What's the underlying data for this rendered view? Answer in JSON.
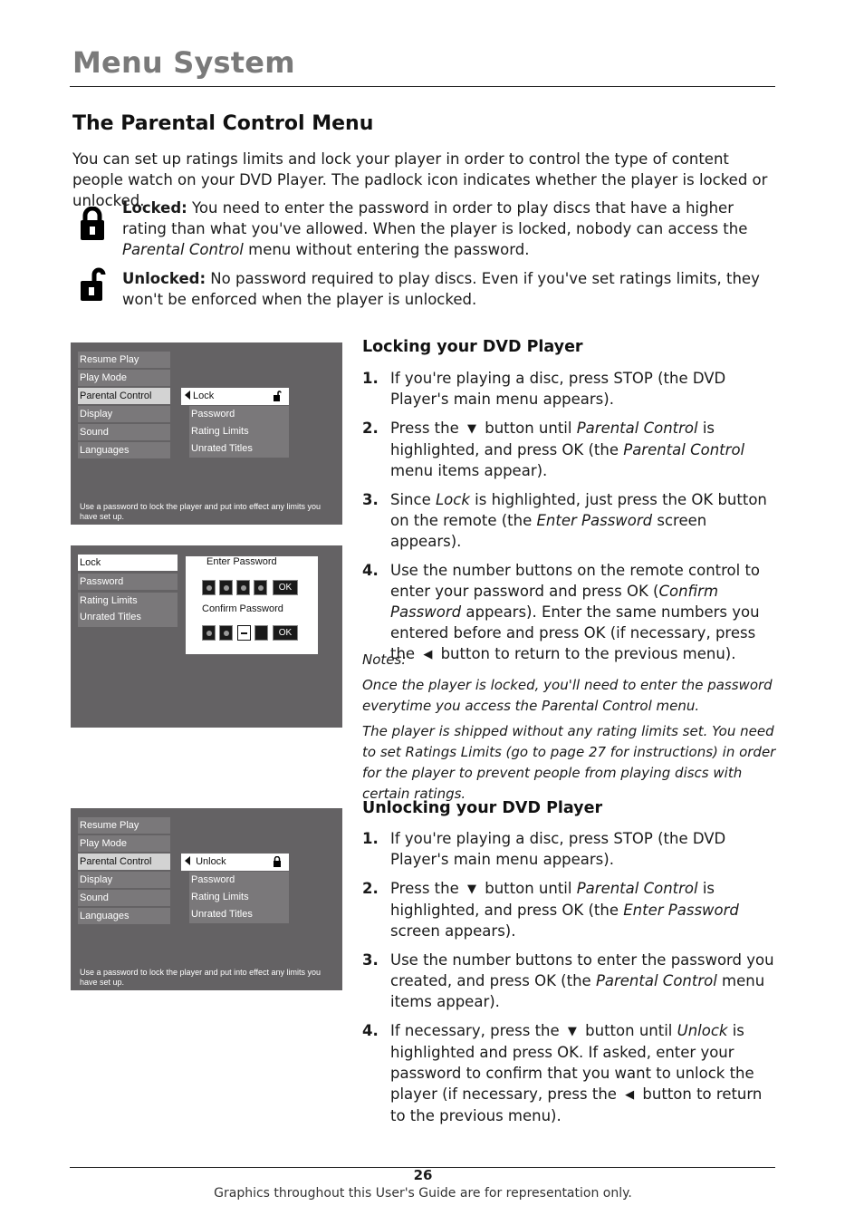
{
  "header": {
    "title": "Menu System"
  },
  "section": {
    "title": "The Parental Control Menu",
    "intro": "You can set up ratings limits and lock your player in order to control the type of content people watch on your DVD Player. The padlock icon indicates whether the player is locked or unlocked."
  },
  "legend": {
    "locked": {
      "icon": "padlock-closed-icon",
      "label": "Locked:",
      "text_before": " You need to enter the password in order to play discs that have a higher rating than what you've allowed. When the player is locked, nobody can access the ",
      "text_italic": "Parental Control",
      "text_after": " menu without entering the password."
    },
    "unlocked": {
      "icon": "padlock-open-icon",
      "label": "Unlocked:",
      "text": " No password required to play discs. Even if you've set ratings limits, they won't be enforced when the player is unlocked."
    }
  },
  "screens": {
    "main_menu": [
      "Resume Play",
      "Play Mode",
      "Parental Control",
      "Display",
      "Sound",
      "Languages"
    ],
    "active_main": "Parental Control",
    "screen1": {
      "selected_sub": "Lock",
      "sub_items": [
        "Password",
        "Rating Limits",
        "Unrated Titles"
      ],
      "note": "Use a password to lock the player and put into effect any limits you have set up."
    },
    "screen2": {
      "left_items": [
        "Lock",
        "Password",
        "Rating Limits",
        "Unrated Titles"
      ],
      "enter_label": "Enter Password",
      "confirm_label": "Confirm Password",
      "ok_label": "OK",
      "enter_digits_filled": 4,
      "confirm_digits_filled": 2
    },
    "screen3": {
      "selected_sub": "Unlock",
      "sub_items": [
        "Password",
        "Rating Limits",
        "Unrated Titles"
      ],
      "note": "Use a password to lock the player and put into effect any limits you have set up."
    }
  },
  "locking": {
    "title": "Locking your DVD Player",
    "steps": [
      {
        "num": "1.",
        "parts": [
          {
            "t": "If you're playing a disc, press STOP (the DVD Player's main menu appears)."
          }
        ]
      },
      {
        "num": "2.",
        "parts": [
          {
            "t": "Press the "
          },
          {
            "arrow": "▼"
          },
          {
            "t": " button until "
          },
          {
            "i": "Parental Control"
          },
          {
            "t": " is highlighted, and press OK (the "
          },
          {
            "i": "Parental Control"
          },
          {
            "t": " menu items appear)."
          }
        ]
      },
      {
        "num": "3.",
        "parts": [
          {
            "t": "Since "
          },
          {
            "i": "Lock"
          },
          {
            "t": " is highlighted, just press the OK button on the remote (the "
          },
          {
            "i": "Enter Password"
          },
          {
            "t": " screen appears)."
          }
        ]
      },
      {
        "num": "4.",
        "parts": [
          {
            "t": "Use the number buttons on the remote control to enter your password and press OK ("
          },
          {
            "i": "Confirm Password"
          },
          {
            "t": " appears). Enter the same numbers you entered before and press OK (if necessary, press the "
          },
          {
            "arrow": "◀"
          },
          {
            "t": " button to return to the previous menu)."
          }
        ]
      }
    ],
    "notes_label": "Notes:",
    "notes": [
      "Once the player is locked, you'll need to enter the password everytime you access the Parental Control menu.",
      "The player is shipped without any rating limits set. You need to set Ratings Limits (go to page 27 for instructions) in order for the player to prevent people from playing discs with certain ratings."
    ]
  },
  "unlocking": {
    "title": "Unlocking your DVD Player",
    "steps": [
      {
        "num": "1.",
        "parts": [
          {
            "t": "If you're playing a disc, press STOP (the DVD Player's main menu appears)."
          }
        ]
      },
      {
        "num": "2.",
        "parts": [
          {
            "t": "Press the "
          },
          {
            "arrow": "▼"
          },
          {
            "t": " button until "
          },
          {
            "i": "Parental Control"
          },
          {
            "t": " is highlighted, and press OK (the "
          },
          {
            "i": "Enter Password"
          },
          {
            "t": " screen appears)."
          }
        ]
      },
      {
        "num": "3.",
        "parts": [
          {
            "t": "Use the number buttons to enter the password you created, and press OK (the "
          },
          {
            "i": "Parental Control"
          },
          {
            "t": " menu items appear)."
          }
        ]
      },
      {
        "num": "4.",
        "parts": [
          {
            "t": "If necessary, press the "
          },
          {
            "arrow": "▼"
          },
          {
            "t": " button until "
          },
          {
            "i": "Unlock"
          },
          {
            "t": " is highlighted and press OK. If asked, enter your password to confirm that you want to unlock the player (if necessary, press the "
          },
          {
            "arrow": "◀"
          },
          {
            "t": " button to return to the previous menu)."
          }
        ]
      }
    ]
  },
  "footer": {
    "page_number": "26",
    "disclaimer": "Graphics throughout this User's Guide are for representation only."
  }
}
